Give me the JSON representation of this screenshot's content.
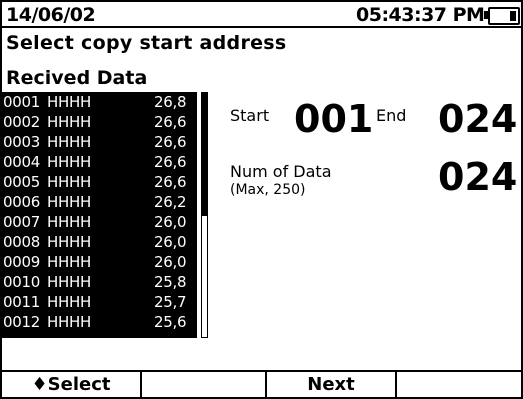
{
  "status": {
    "date": "14/06/02",
    "time": "05:43:37 PM",
    "battery_icon": "battery-low-icon"
  },
  "page": {
    "title": "Select copy start address"
  },
  "list": {
    "title": "Recived Data",
    "rows": [
      {
        "id": "0001",
        "code": "HHHH",
        "value": "26,8"
      },
      {
        "id": "0002",
        "code": "HHHH",
        "value": "26,6"
      },
      {
        "id": "0003",
        "code": "HHHH",
        "value": "26,6"
      },
      {
        "id": "0004",
        "code": "HHHH",
        "value": "26,6"
      },
      {
        "id": "0005",
        "code": "HHHH",
        "value": "26,6"
      },
      {
        "id": "0006",
        "code": "HHHH",
        "value": "26,2"
      },
      {
        "id": "0007",
        "code": "HHHH",
        "value": "26,0"
      },
      {
        "id": "0008",
        "code": "HHHH",
        "value": "26,0"
      },
      {
        "id": "0009",
        "code": "HHHH",
        "value": "26,0"
      },
      {
        "id": "0010",
        "code": "HHHH",
        "value": "25,8"
      },
      {
        "id": "0011",
        "code": "HHHH",
        "value": "25,7"
      },
      {
        "id": "0012",
        "code": "HHHH",
        "value": "25,6"
      }
    ]
  },
  "range": {
    "start_label": "Start",
    "start_value": "001",
    "end_label": "End",
    "end_value": "024",
    "num_label": "Num of Data",
    "num_note": "(Max, 250)",
    "num_value": "024"
  },
  "softkeys": [
    {
      "label": "♦Select"
    },
    {
      "label": ""
    },
    {
      "label": "Next"
    },
    {
      "label": ""
    }
  ],
  "colors": {
    "foreground": "#000000",
    "background": "#ffffff"
  }
}
